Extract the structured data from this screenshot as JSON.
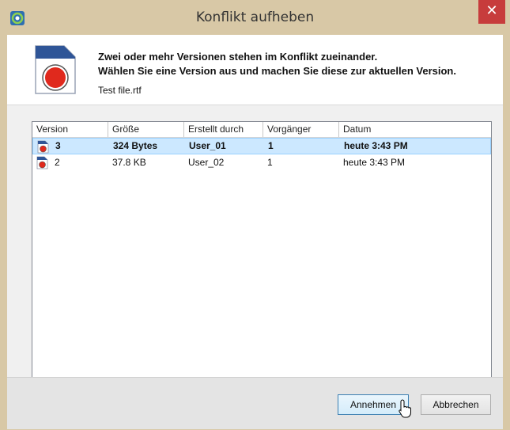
{
  "window": {
    "title": "Konflikt aufheben",
    "close_glyph": "✕"
  },
  "header": {
    "line1": "Zwei oder mehr Versionen stehen im Konflikt zueinander.",
    "line2": "Wählen Sie eine Version aus und machen Sie diese zur aktuellen Version.",
    "filename": "Test file.rtf"
  },
  "table": {
    "columns": [
      "Version",
      "Größe",
      "Erstellt durch",
      "Vorgänger",
      "Datum"
    ],
    "rows": [
      {
        "version": "3",
        "size": "324 Bytes",
        "created_by": "User_01",
        "predecessor": "1",
        "date": "heute 3:43 PM",
        "selected": true
      },
      {
        "version": "2",
        "size": "37.8 KB",
        "created_by": "User_02",
        "predecessor": "1",
        "date": "heute 3:43 PM",
        "selected": false
      }
    ]
  },
  "buttons": {
    "accept": "Annehmen",
    "cancel": "Abbrechen"
  },
  "icons": {
    "file_icon": "rtf-document-icon",
    "app_icon": "sync-app-icon",
    "cursor": "mouse-pointer-icon"
  },
  "colors": {
    "titlebar": "#d8c8a6",
    "selection": "#cce8ff",
    "close": "#c73c3c",
    "icon_red": "#e0291d"
  }
}
